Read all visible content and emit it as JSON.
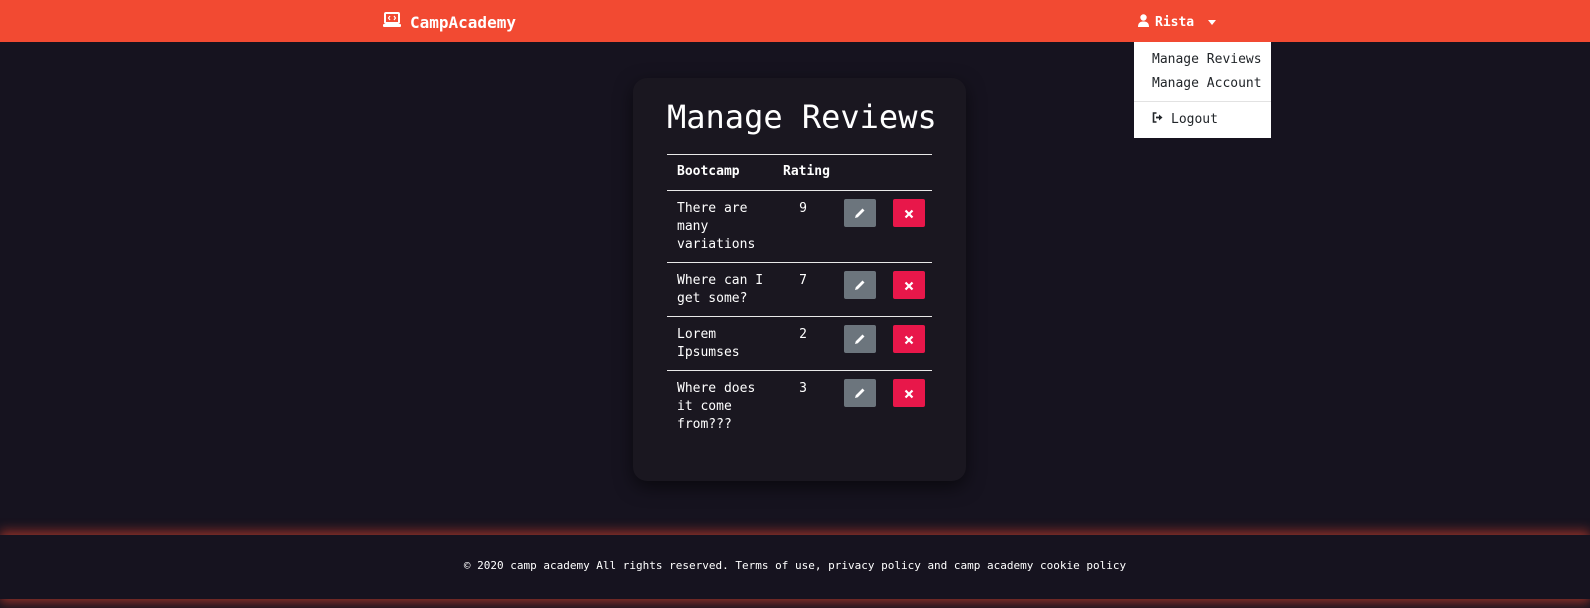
{
  "navbar": {
    "brand": "CampAcademy",
    "brand_icon": "laptop-code-icon",
    "user": "Rista",
    "user_icon": "user-icon"
  },
  "dropdown": {
    "items": [
      "Manage Reviews",
      "Manage Account"
    ],
    "logout": "Logout"
  },
  "main": {
    "title": "Manage Reviews",
    "table": {
      "headers": [
        "Bootcamp",
        "Rating"
      ],
      "rows": [
        {
          "bootcamp": "There are many variations",
          "rating": "9"
        },
        {
          "bootcamp": "Where can I get some?",
          "rating": "7"
        },
        {
          "bootcamp": "Lorem Ipsumses",
          "rating": "2"
        },
        {
          "bootcamp": "Where does it come from???",
          "rating": "3"
        }
      ]
    }
  },
  "footer": {
    "text": "© 2020 camp academy All rights reserved. Terms of use, privacy policy and camp academy cookie policy"
  },
  "colors": {
    "accent": "#f24a32",
    "background": "#16131f",
    "card": "#1a1720",
    "edit_button": "#6c757d",
    "delete_button": "#e8174a"
  }
}
